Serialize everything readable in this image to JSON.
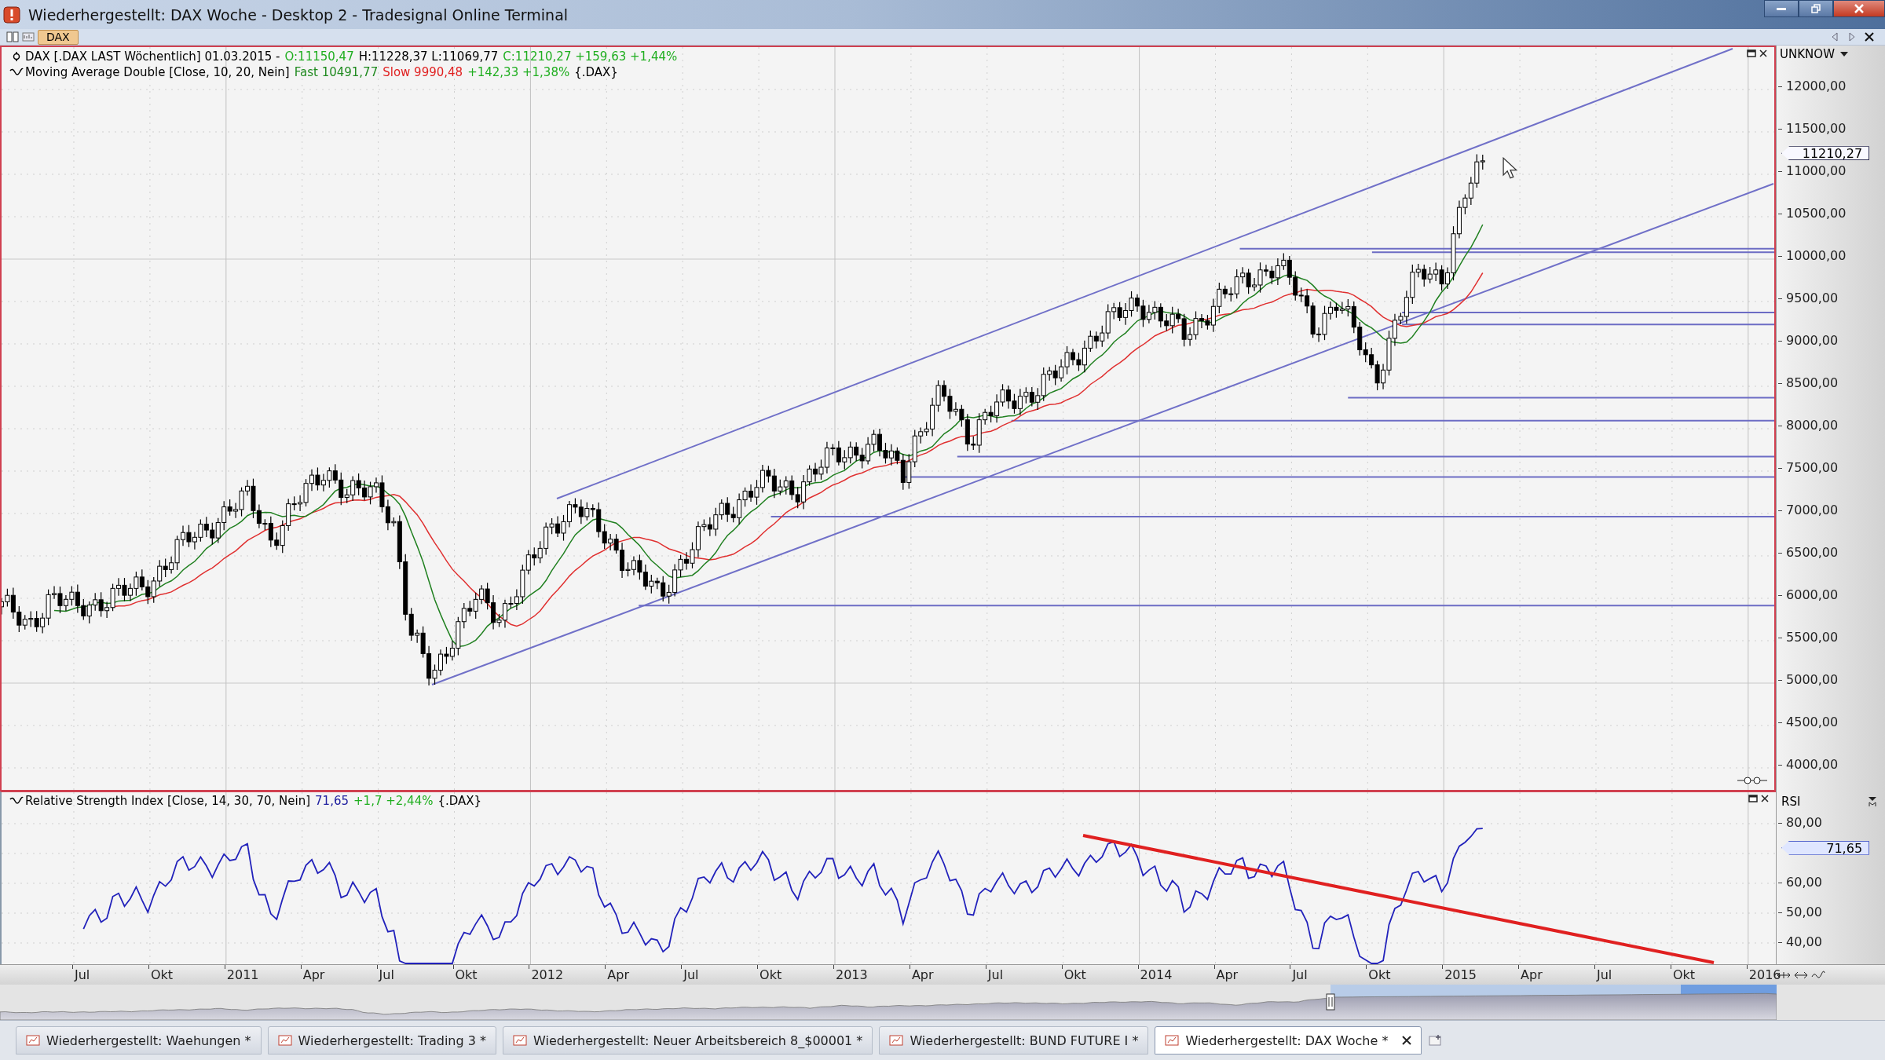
{
  "window": {
    "title": "Wiederhergestellt: DAX Woche - Desktop 2 - Tradesignal Online Terminal"
  },
  "toolbar": {
    "tab": "DAX"
  },
  "price_panel": {
    "legend": [
      [
        {
          "text": "DAX [.DAX LAST Wöchentlich] 01.03.2015 -",
          "color": "#000000"
        },
        {
          "text": "O:11150,47",
          "color": "#1fae1f"
        },
        {
          "text": "H:11228,37 L:11069,77",
          "color": "#000000"
        },
        {
          "text": "C:11210,27 +159,63 +1,44%",
          "color": "#1fae1f"
        }
      ],
      [
        {
          "text": "Moving Average Double [Close, 10, 20, Nein]",
          "color": "#000000"
        },
        {
          "text": "Fast 10491,77",
          "color": "#1f8a1f"
        },
        {
          "text": "Slow 9990,48",
          "color": "#e02020"
        },
        {
          "text": "+142,33 +1,38%",
          "color": "#1fae1f"
        },
        {
          "text": "{.DAX}",
          "color": "#000000"
        }
      ]
    ],
    "axis": {
      "selector": "UNKNOW",
      "ticks": [
        "12000,00",
        "11500,00",
        "11000,00",
        "10500,00",
        "10000,00",
        "9500,00",
        "9000,00",
        "8500,00",
        "8000,00",
        "7500,00",
        "7000,00",
        "6500,00",
        "6000,00",
        "5500,00",
        "5000,00",
        "4500,00",
        "4000,00"
      ],
      "last_value": "11210,27"
    }
  },
  "rsi_panel": {
    "legend": [
      {
        "text": "Relative Strength Index [Close, 14, 30, 70, Nein]",
        "color": "#000000"
      },
      {
        "text": "71,65",
        "color": "#2020a0"
      },
      {
        "text": "+1,7 +2,44%",
        "color": "#1fae1f"
      },
      {
        "text": "{.DAX}",
        "color": "#000000"
      }
    ],
    "axis": {
      "title": "RSI",
      "ticks": [
        "80,00",
        "60,00",
        "50,00",
        "40,00"
      ],
      "last_value": "71,65"
    }
  },
  "time_axis": [
    "Jul",
    "Okt",
    "2011",
    "Apr",
    "Jul",
    "Okt",
    "2012",
    "Apr",
    "Jul",
    "Okt",
    "2013",
    "Apr",
    "Jul",
    "Okt",
    "2014",
    "Apr",
    "Jul",
    "Okt",
    "2015",
    "Apr",
    "Jul",
    "Okt",
    "2016"
  ],
  "tabs": [
    {
      "label": "Wiederhergestellt: Waehungen *",
      "selected": false
    },
    {
      "label": "Wiederhergestellt: Trading 3 *",
      "selected": false
    },
    {
      "label": "Wiederhergestellt: Neuer Arbeitsbereich 8_$00001 *",
      "selected": false
    },
    {
      "label": "Wiederhergestellt: BUND FUTURE I *",
      "selected": false
    },
    {
      "label": "Wiederhergestellt: DAX Woche *",
      "selected": true
    }
  ]
}
